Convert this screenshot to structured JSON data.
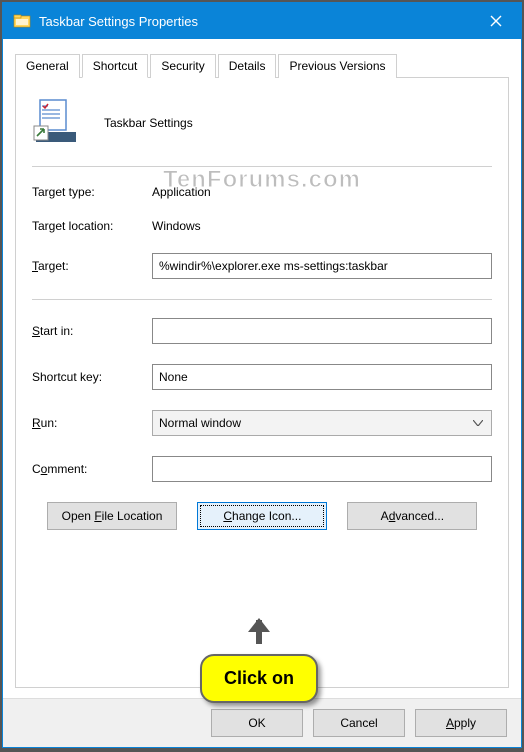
{
  "window": {
    "title": "Taskbar Settings Properties"
  },
  "tabs": {
    "general": "General",
    "shortcut": "Shortcut",
    "security": "Security",
    "details": "Details",
    "previous": "Previous Versions"
  },
  "header": {
    "name": "Taskbar Settings"
  },
  "watermark": "TenForums.com",
  "fields": {
    "target_type_label": "Target type:",
    "target_type_value": "Application",
    "target_location_label": "Target location:",
    "target_location_value": "Windows",
    "target_label": "Target:",
    "target_value": "%windir%\\explorer.exe ms-settings:taskbar",
    "startin_label": "Start in:",
    "startin_value": "",
    "shortcutkey_label": "Shortcut key:",
    "shortcutkey_value": "None",
    "run_label": "Run:",
    "run_value": "Normal window",
    "comment_label": "Comment:",
    "comment_value": ""
  },
  "buttons": {
    "open_file_location": "Open File Location",
    "change_icon": "Change Icon...",
    "advanced": "Advanced..."
  },
  "footer": {
    "ok": "OK",
    "cancel": "Cancel",
    "apply": "Apply"
  },
  "callout": "Click on"
}
